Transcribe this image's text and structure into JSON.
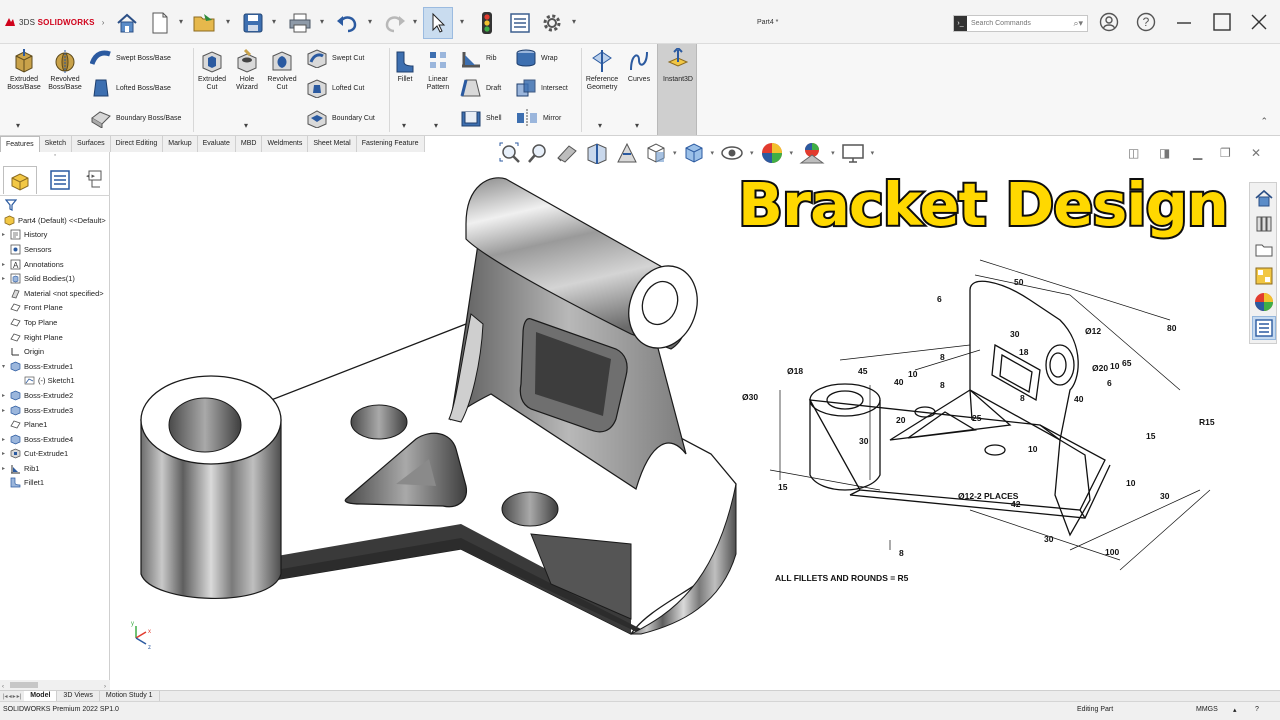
{
  "app": {
    "brand_ds": "3DS",
    "brand": "SOLIDWORKS",
    "doc_title": "Part4 *"
  },
  "quick_access": [
    {
      "name": "home-icon"
    },
    {
      "name": "new-document-icon"
    },
    {
      "name": "open-icon"
    },
    {
      "name": "save-icon"
    },
    {
      "name": "print-icon"
    },
    {
      "name": "undo-icon"
    },
    {
      "name": "redo-icon"
    },
    {
      "name": "select-icon"
    },
    {
      "name": "rebuild-icon"
    },
    {
      "name": "file-properties-icon"
    },
    {
      "name": "options-icon"
    }
  ],
  "search": {
    "placeholder": "Search Commands"
  },
  "ribbon": {
    "extruded_boss": "Extruded Boss/Base",
    "revolved_boss": "Revolved Boss/Base",
    "swept_boss": "Swept Boss/Base",
    "lofted_boss": "Lofted Boss/Base",
    "boundary_boss": "Boundary Boss/Base",
    "extruded_cut": "Extruded Cut",
    "hole_wizard": "Hole Wizard",
    "revolved_cut": "Revolved Cut",
    "swept_cut": "Swept Cut",
    "lofted_cut": "Lofted Cut",
    "boundary_cut": "Boundary Cut",
    "fillet": "Fillet",
    "linear_pattern": "Linear Pattern",
    "rib": "Rib",
    "wrap": "Wrap",
    "draft": "Draft",
    "intersect": "Intersect",
    "shell": "Shell",
    "mirror": "Mirror",
    "reference_geometry": "Reference Geometry",
    "curves": "Curves",
    "instant3d": "Instant3D"
  },
  "tabs": [
    "Features",
    "Sketch",
    "Surfaces",
    "Direct Editing",
    "Markup",
    "Evaluate",
    "MBD",
    "Weldments",
    "Sheet Metal",
    "Fastening Feature"
  ],
  "feature_tree": {
    "root": "Part4 (Default) <<Default>",
    "items": [
      {
        "label": "History",
        "icon": "history-icon",
        "expand": "▸"
      },
      {
        "label": "Sensors",
        "icon": "sensors-icon",
        "expand": ""
      },
      {
        "label": "Annotations",
        "icon": "annotations-icon",
        "expand": "▸"
      },
      {
        "label": "Solid Bodies(1)",
        "icon": "solid-bodies-icon",
        "expand": "▸"
      },
      {
        "label": "Material <not specified>",
        "icon": "material-icon",
        "expand": ""
      },
      {
        "label": "Front Plane",
        "icon": "plane-icon",
        "expand": ""
      },
      {
        "label": "Top Plane",
        "icon": "plane-icon",
        "expand": ""
      },
      {
        "label": "Right Plane",
        "icon": "plane-icon",
        "expand": ""
      },
      {
        "label": "Origin",
        "icon": "origin-icon",
        "expand": ""
      },
      {
        "label": "Boss-Extrude1",
        "icon": "extrude-icon",
        "expand": "▾"
      },
      {
        "label": "(-) Sketch1",
        "icon": "sketch-icon",
        "expand": "",
        "child": true
      },
      {
        "label": "Boss-Extrude2",
        "icon": "extrude-icon",
        "expand": "▸"
      },
      {
        "label": "Boss-Extrude3",
        "icon": "extrude-icon",
        "expand": "▸"
      },
      {
        "label": "Plane1",
        "icon": "plane-icon",
        "expand": ""
      },
      {
        "label": "Boss-Extrude4",
        "icon": "extrude-icon",
        "expand": "▸"
      },
      {
        "label": "Cut-Extrude1",
        "icon": "cut-icon",
        "expand": "▸"
      },
      {
        "label": "Rib1",
        "icon": "rib-icon",
        "expand": "▸"
      },
      {
        "label": "Fillet1",
        "icon": "fillet-icon",
        "expand": ""
      }
    ]
  },
  "canvas": {
    "headline": "Bracket Design",
    "triad": {
      "x": "x",
      "y": "y",
      "z": "z"
    }
  },
  "drawing": {
    "dims": [
      "50",
      "6",
      "30",
      "Ø12",
      "65",
      "80",
      "45",
      "40",
      "8",
      "18",
      "Ø20",
      "10",
      "6",
      "40",
      "Ø18",
      "Ø30",
      "8",
      "8",
      "20",
      "25",
      "R15",
      "30",
      "10",
      "15",
      "30",
      "Ø12-2 PLACES",
      "42",
      "10",
      "15",
      "30",
      "100",
      "8",
      "10"
    ],
    "note": "ALL FILLETS AND ROUNDS = R5"
  },
  "bottom_tabs": [
    "Model",
    "3D Views",
    "Motion Study 1"
  ],
  "status": {
    "product": "SOLIDWORKS Premium 2022 SP1.0",
    "mode": "Editing Part",
    "units": "MMGS"
  }
}
